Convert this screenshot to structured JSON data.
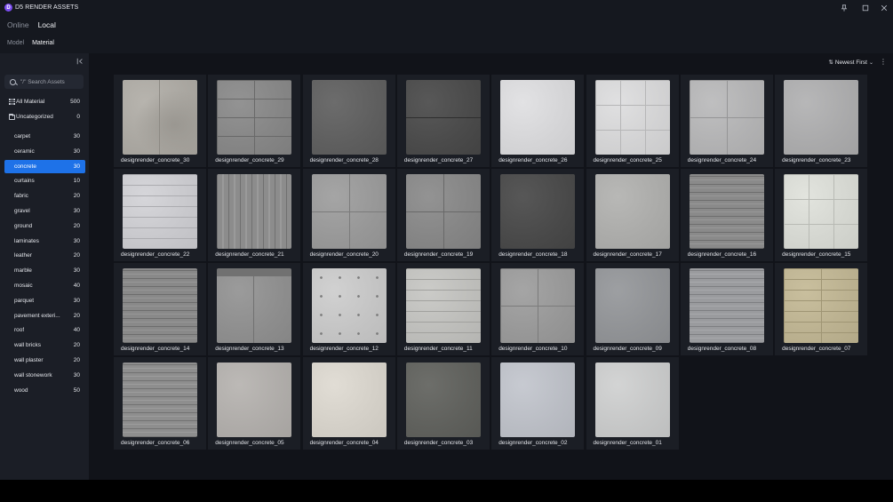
{
  "window": {
    "title": "D5 RENDER ASSETS",
    "logo_letter": "D",
    "pin_icon": "pin-icon",
    "maximize_icon": "maximize-icon",
    "close_icon": "close-icon"
  },
  "source_tabs": [
    {
      "label": "Online",
      "active": false
    },
    {
      "label": "Local",
      "active": true
    }
  ],
  "category_tabs": [
    {
      "label": "Model",
      "active": false
    },
    {
      "label": "Material",
      "active": true
    }
  ],
  "sidebar": {
    "search_placeholder": "\"/\" Search Assets",
    "top_items": [
      {
        "label": "All Material",
        "count": "500",
        "icon": "grid-icon"
      },
      {
        "label": "Uncategorized",
        "count": "0",
        "icon": "folder-icon"
      }
    ],
    "categories": [
      {
        "label": "carpet",
        "count": "30"
      },
      {
        "label": "ceramic",
        "count": "30"
      },
      {
        "label": "concrete",
        "count": "30",
        "selected": true
      },
      {
        "label": "curtains",
        "count": "10"
      },
      {
        "label": "fabric",
        "count": "20"
      },
      {
        "label": "gravel",
        "count": "30"
      },
      {
        "label": "ground",
        "count": "20"
      },
      {
        "label": "laminates",
        "count": "30"
      },
      {
        "label": "leather",
        "count": "20"
      },
      {
        "label": "marble",
        "count": "30"
      },
      {
        "label": "mosaic",
        "count": "40"
      },
      {
        "label": "parquet",
        "count": "30"
      },
      {
        "label": "pavement exteri...",
        "count": "20"
      },
      {
        "label": "roof",
        "count": "40"
      },
      {
        "label": "wall bricks",
        "count": "20"
      },
      {
        "label": "wall plaster",
        "count": "20"
      },
      {
        "label": "wall stonework",
        "count": "30"
      },
      {
        "label": "wood",
        "count": "50"
      }
    ]
  },
  "toolbar": {
    "sort_label": "Newest First",
    "sort_icon": "sort-icon",
    "more_icon": "more-icon"
  },
  "materials": [
    {
      "name": "designrender_concrete_30",
      "color": "#a9a6a0",
      "pattern": "stain-vline"
    },
    {
      "name": "designrender_concrete_29",
      "color": "#858585",
      "pattern": "grid-small"
    },
    {
      "name": "designrender_concrete_28",
      "color": "#5e5e5e",
      "pattern": "plain"
    },
    {
      "name": "designrender_concrete_27",
      "color": "#4a4a4a",
      "pattern": "hline"
    },
    {
      "name": "designrender_concrete_26",
      "color": "#d4d4d6",
      "pattern": "plain"
    },
    {
      "name": "designrender_concrete_25",
      "color": "#d2d2d3",
      "pattern": "grid-offset"
    },
    {
      "name": "designrender_concrete_24",
      "color": "#b1b1b2",
      "pattern": "grid-large"
    },
    {
      "name": "designrender_concrete_23",
      "color": "#a9a9aa",
      "pattern": "plain"
    },
    {
      "name": "designrender_concrete_22",
      "color": "#c8c8cc",
      "pattern": "hlines"
    },
    {
      "name": "designrender_concrete_21",
      "color": "#8c8c8c",
      "pattern": "streaks"
    },
    {
      "name": "designrender_concrete_20",
      "color": "#979797",
      "pattern": "grid-cross"
    },
    {
      "name": "designrender_concrete_19",
      "color": "#858585",
      "pattern": "grid-cross"
    },
    {
      "name": "designrender_concrete_18",
      "color": "#494949",
      "pattern": "plain"
    },
    {
      "name": "designrender_concrete_17",
      "color": "#aaaaa8",
      "pattern": "plain"
    },
    {
      "name": "designrender_concrete_16",
      "color": "#8a8a8a",
      "pattern": "boards"
    },
    {
      "name": "designrender_concrete_15",
      "color": "#d4d6d0",
      "pattern": "grid-offset"
    },
    {
      "name": "designrender_concrete_14",
      "color": "#898989",
      "pattern": "boards"
    },
    {
      "name": "designrender_concrete_13",
      "color": "#8d8d8d",
      "pattern": "band-top"
    },
    {
      "name": "designrender_concrete_12",
      "color": "#c3c3c3",
      "pattern": "dots"
    },
    {
      "name": "designrender_concrete_11",
      "color": "#bdbdba",
      "pattern": "hlines"
    },
    {
      "name": "designrender_concrete_10",
      "color": "#979797",
      "pattern": "grid-large"
    },
    {
      "name": "designrender_concrete_09",
      "color": "#8f9194",
      "pattern": "plain"
    },
    {
      "name": "designrender_concrete_08",
      "color": "#9a9b9e",
      "pattern": "boards"
    },
    {
      "name": "designrender_concrete_07",
      "color": "#bbb190",
      "pattern": "brick"
    },
    {
      "name": "designrender_concrete_06",
      "color": "#8e8e8e",
      "pattern": "boards"
    },
    {
      "name": "designrender_concrete_05",
      "color": "#aeaba8",
      "pattern": "plain"
    },
    {
      "name": "designrender_concrete_04",
      "color": "#d3cfc7",
      "pattern": "plain"
    },
    {
      "name": "designrender_concrete_03",
      "color": "#5f605c",
      "pattern": "plain"
    },
    {
      "name": "designrender_concrete_02",
      "color": "#b9bcc3",
      "pattern": "plain"
    },
    {
      "name": "designrender_concrete_01",
      "color": "#c5c6c6",
      "pattern": "plain"
    }
  ]
}
